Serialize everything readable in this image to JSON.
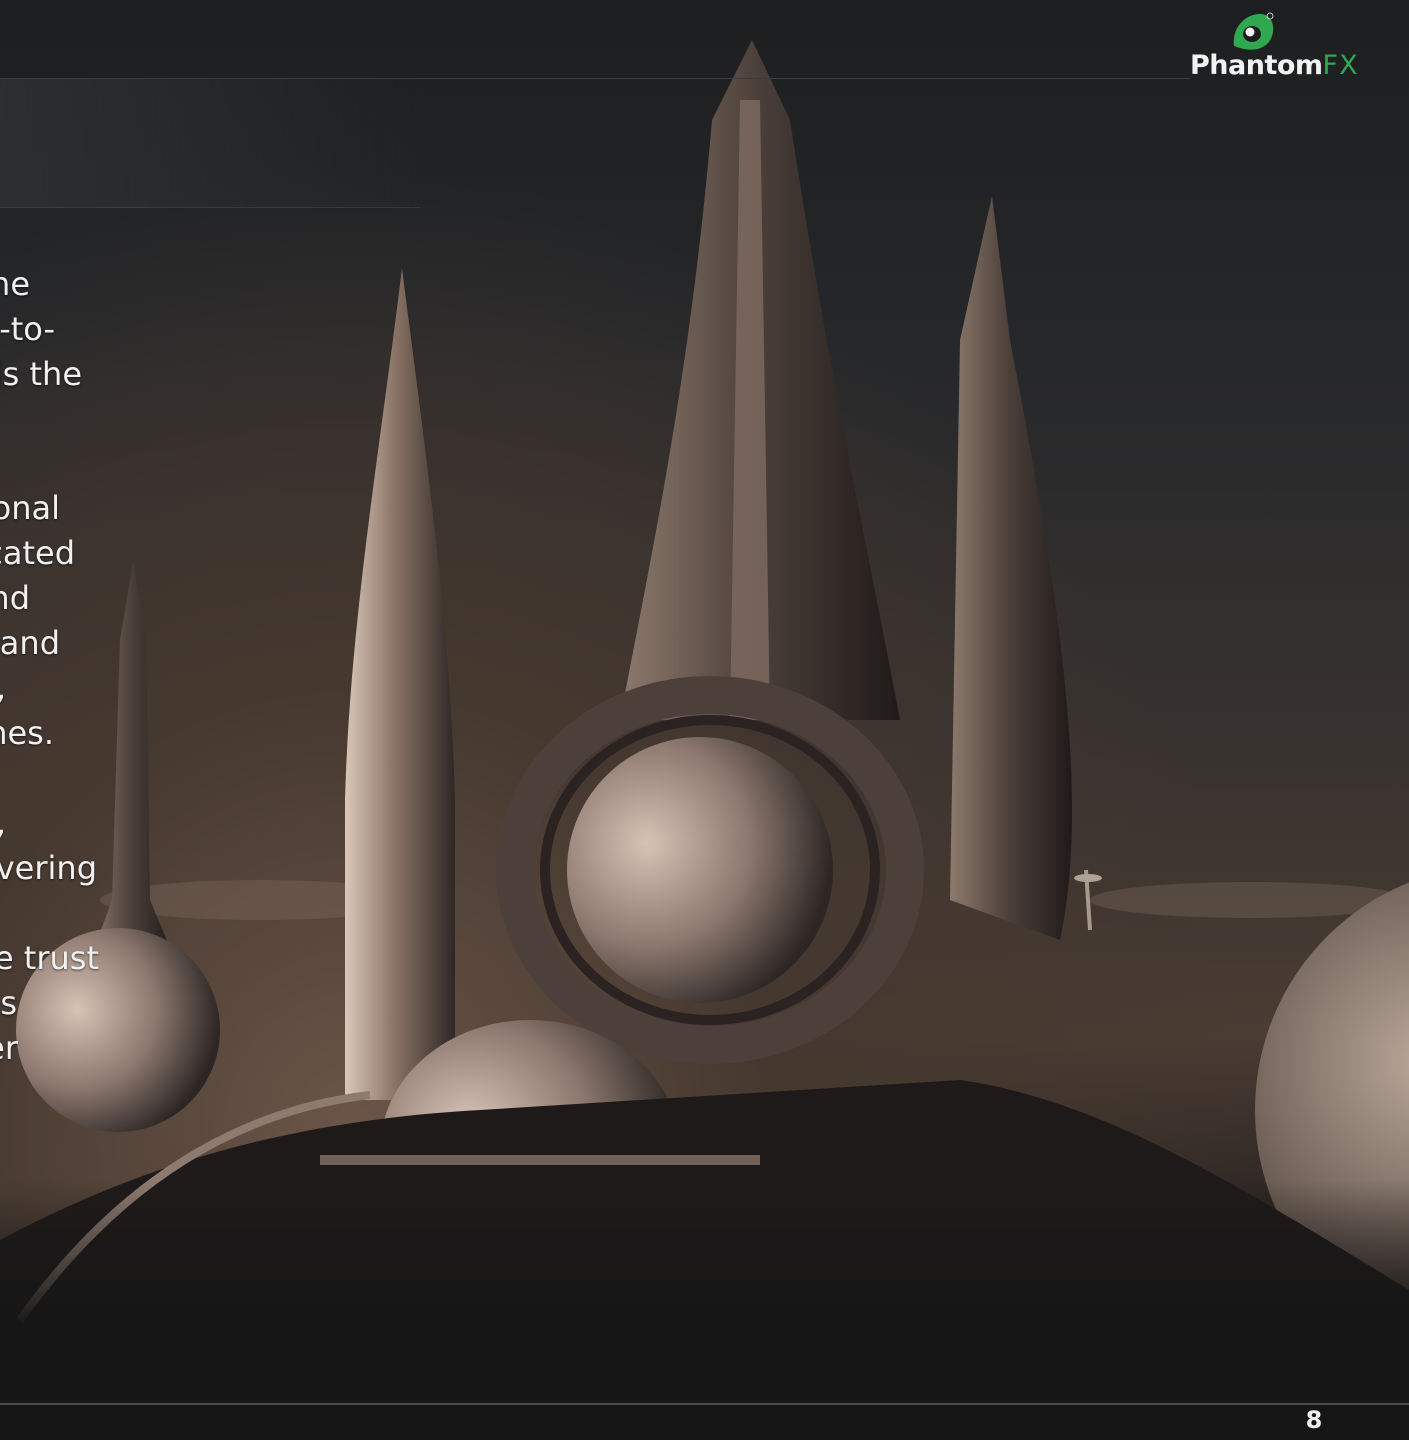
{
  "logo": {
    "brand_main": "Phantom",
    "brand_accent": "FX",
    "registered_mark": "®",
    "colors": {
      "accent": "#2fa84f",
      "text": "#f2f2f2"
    }
  },
  "body_text": {
    "lines": [
      "he",
      "-to-",
      "ls the",
      "onal",
      "cated",
      "nd",
      "and",
      ",",
      "nes.",
      ",",
      "vering",
      "e trust",
      "s",
      "er"
    ]
  },
  "footer": {
    "page_number": "8"
  },
  "colors": {
    "background": "#161616",
    "rule": "#4b4b4b"
  }
}
